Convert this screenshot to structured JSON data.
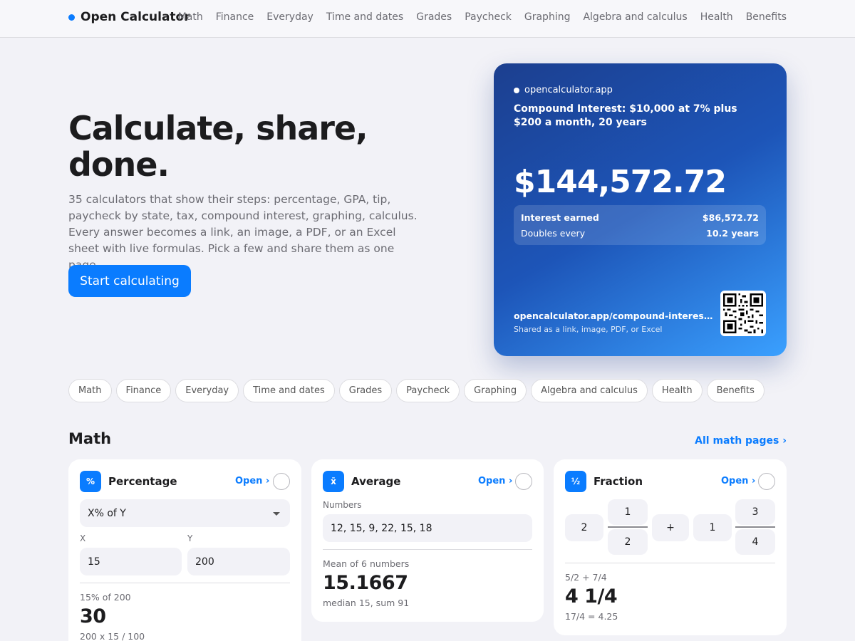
{
  "brand": {
    "name": "Open Calculator",
    "accent": "#0a7cff"
  },
  "nav": [
    "Math",
    "Finance",
    "Everyday",
    "Time and dates",
    "Grades",
    "Paycheck",
    "Graphing",
    "Algebra and calculus",
    "Health",
    "Benefits"
  ],
  "hero": {
    "title": "Calculate, share, done.",
    "subtitle": "35 calculators that show their steps: percentage, GPA, tip, paycheck by state, tax, compound interest, graphing, calculus. Every answer becomes a link, an image, a PDF, or an Excel sheet with live formulas. Pick a few and share them as one page.",
    "cta": "Start calculating"
  },
  "card": {
    "site": "opencalculator.app",
    "description": "Compound Interest: $10,000 at 7% plus $200 a month, 20 years",
    "amount": "$144,572.72",
    "stats": [
      {
        "label": "Interest earned",
        "value": "$86,572.72"
      },
      {
        "label": "Doubles every",
        "value": "10.2 years"
      }
    ],
    "link": "opencalculator.app/compound-interest-calculator",
    "link_note": "Shared as a link, image, PDF, or Excel",
    "qr": "qr-code-icon"
  },
  "chips": [
    "Math",
    "Finance",
    "Everyday",
    "Time and dates",
    "Grades",
    "Paycheck",
    "Graphing",
    "Algebra and calculus",
    "Health",
    "Benefits"
  ],
  "math": {
    "title": "Math",
    "all_link": "All math pages ›",
    "open_label": "Open ›",
    "percentage": {
      "name": "Percentage",
      "icon": "%",
      "mode": "X% of Y",
      "x_label": "X",
      "x_value": "15",
      "y_label": "Y",
      "y_value": "200",
      "caption": "15% of 200",
      "result": "30",
      "detail": "200 x 15 / 100"
    },
    "average": {
      "name": "Average",
      "icon": "x̄",
      "numbers_label": "Numbers",
      "numbers_value": "12, 15, 9, 22, 15, 18",
      "caption": "Mean of 6 numbers",
      "result": "15.1667",
      "detail": "median 15, sum 91"
    },
    "fraction": {
      "name": "Fraction",
      "icon": "½",
      "whole1": "2",
      "num1": "1",
      "den1": "2",
      "operator": "+",
      "whole2": "1",
      "num2": "3",
      "den2": "4",
      "caption": "5/2 + 7/4",
      "result": "4 1/4",
      "detail": "17/4 = 4.25"
    }
  }
}
